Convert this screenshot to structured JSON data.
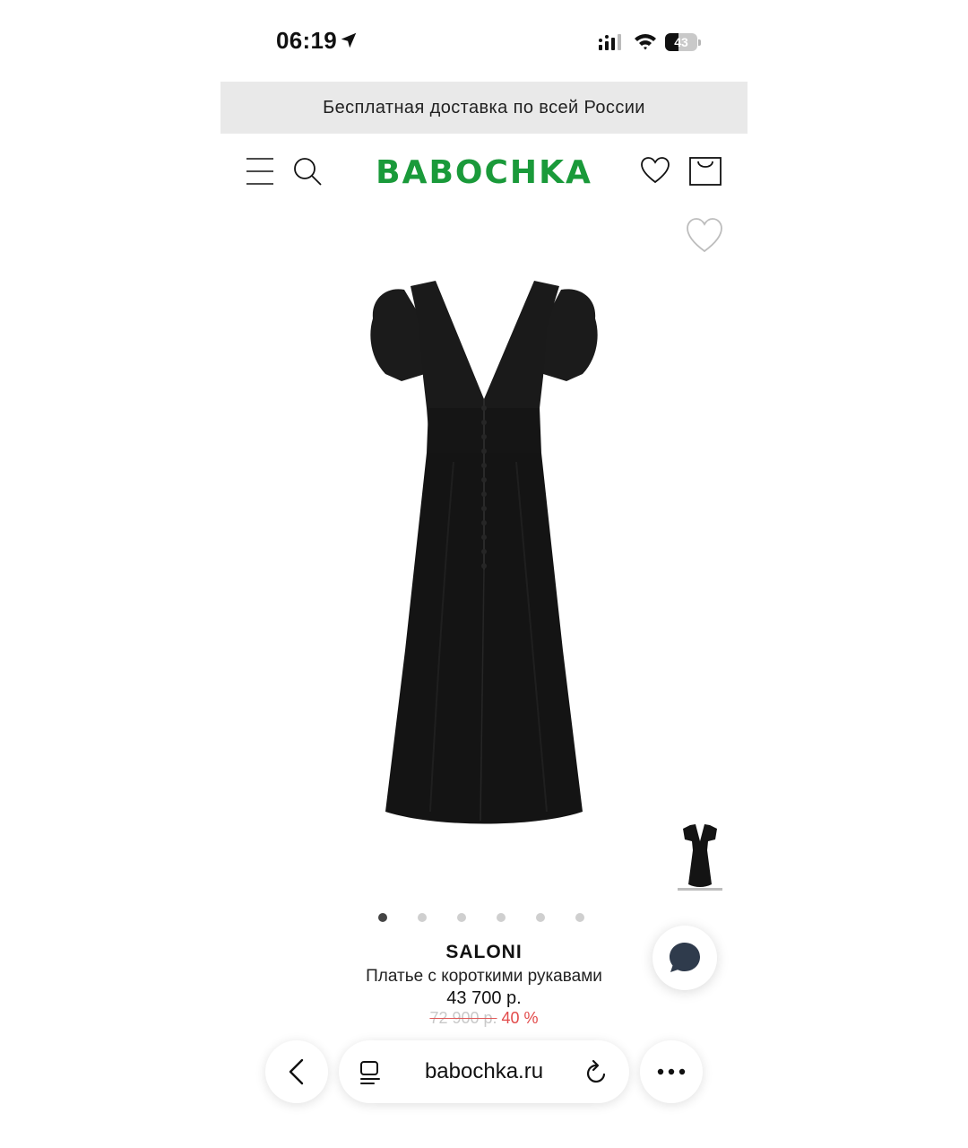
{
  "status_bar": {
    "time": "06:19",
    "battery_label": "43",
    "battery_level": 0.43,
    "icons": [
      "location-arrow-icon",
      "cellular-signal-icon",
      "wifi-icon",
      "battery-icon"
    ]
  },
  "promo_banner": {
    "text": "Бесплатная доставка по всей России"
  },
  "header": {
    "logo": "BABOCHKA",
    "icons": [
      "menu-icon",
      "search-icon",
      "heart-icon",
      "shopping-bag-icon"
    ]
  },
  "gallery": {
    "image_count": 6,
    "active_index": 0
  },
  "product": {
    "brand": "SALONI",
    "name": "Платье с короткими рукавами",
    "price": "43 700 р.",
    "old_price": "72 900 р.",
    "discount": "40 %"
  },
  "browser": {
    "url": "babochka.ru",
    "icons": [
      "back-chevron-icon",
      "reader-mode-icon",
      "reload-icon",
      "more-dots-icon"
    ]
  },
  "colors": {
    "brand_green": "#1a9a3a",
    "discount_red": "#e24a4a",
    "banner_bg": "#e9e9e9",
    "chat_icon": "#2f3b4c"
  }
}
